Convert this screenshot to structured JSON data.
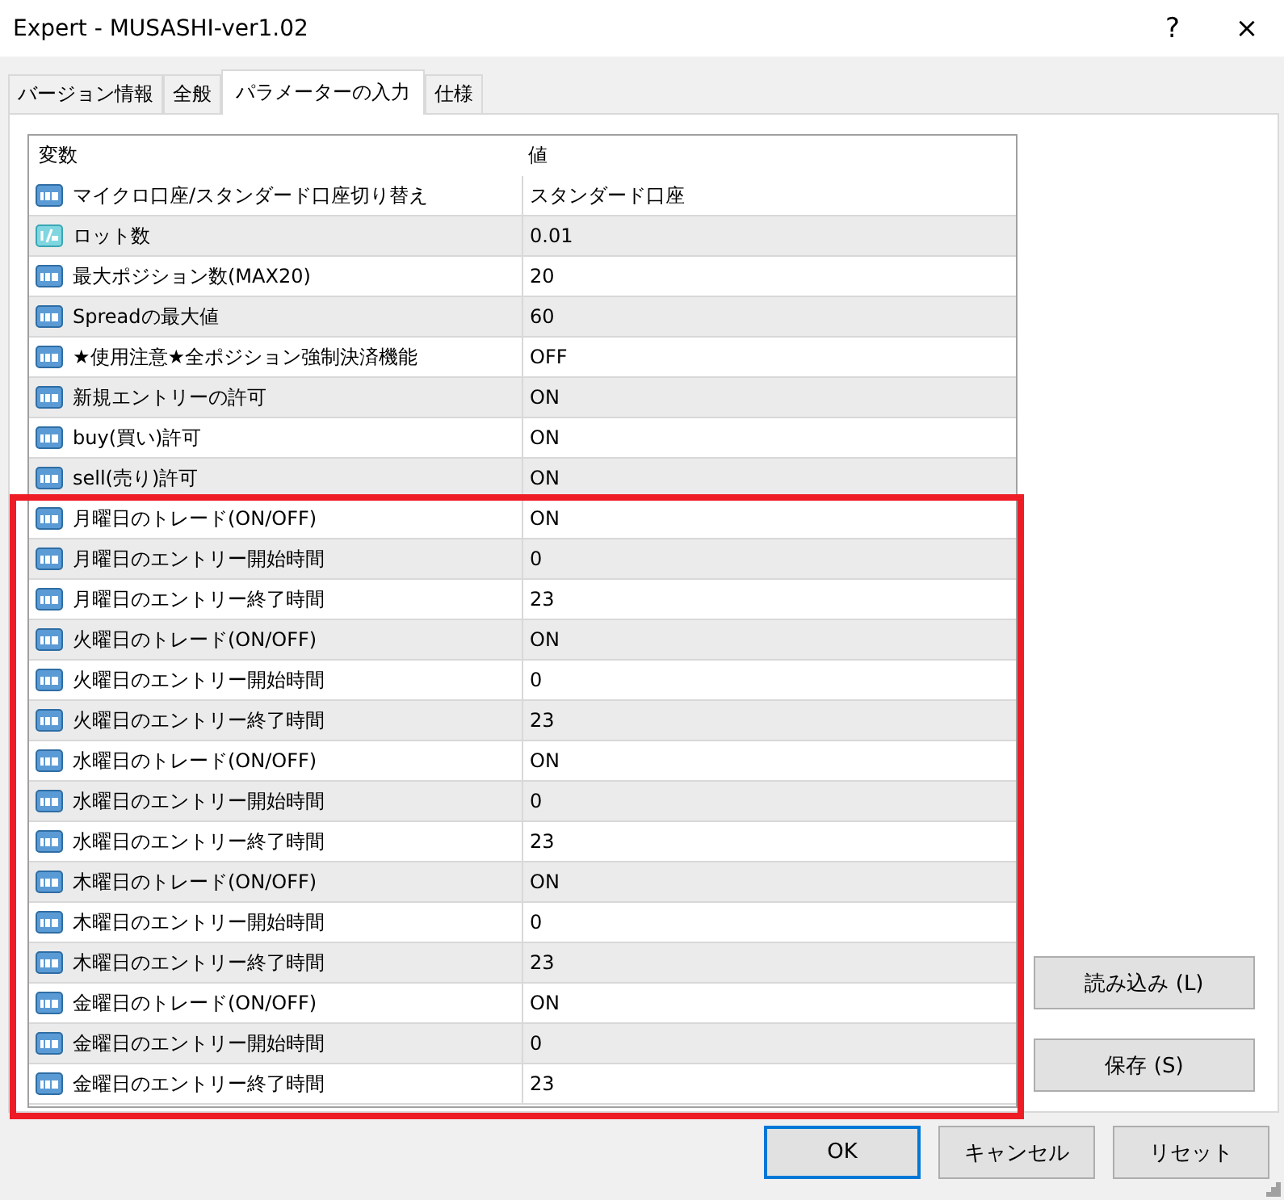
{
  "window": {
    "title": "Expert - MUSASHI-ver1.02",
    "help": "?",
    "close": "×"
  },
  "tabs": [
    {
      "label": "バージョン情報",
      "selected": false
    },
    {
      "label": "全般",
      "selected": false
    },
    {
      "label": "パラメーターの入力",
      "selected": true
    },
    {
      "label": "仕様",
      "selected": false
    }
  ],
  "table": {
    "columns": [
      "変数",
      "値"
    ],
    "rows": [
      {
        "kind": "int",
        "name": "マイクロ口座/スタンダード口座切り替え",
        "value": "スタンダード口座"
      },
      {
        "kind": "double",
        "name": "ロット数",
        "value": "0.01"
      },
      {
        "kind": "int",
        "name": "最大ポジション数(MAX20)",
        "value": "20"
      },
      {
        "kind": "int",
        "name": "Spreadの最大値",
        "value": "60"
      },
      {
        "kind": "int",
        "name": "★使用注意★全ポジション強制決済機能",
        "value": "OFF"
      },
      {
        "kind": "int",
        "name": "新規エントリーの許可",
        "value": "ON"
      },
      {
        "kind": "int",
        "name": "buy(買い)許可",
        "value": "ON"
      },
      {
        "kind": "int",
        "name": "sell(売り)許可",
        "value": "ON"
      }
    ],
    "highlighted_rows": [
      {
        "kind": "int",
        "name": "月曜日のトレード(ON/OFF)",
        "value": "ON"
      },
      {
        "kind": "int",
        "name": "月曜日のエントリー開始時間",
        "value": "0"
      },
      {
        "kind": "int",
        "name": "月曜日のエントリー終了時間",
        "value": "23"
      },
      {
        "kind": "int",
        "name": "火曜日のトレード(ON/OFF)",
        "value": "ON"
      },
      {
        "kind": "int",
        "name": "火曜日のエントリー開始時間",
        "value": "0"
      },
      {
        "kind": "int",
        "name": "火曜日のエントリー終了時間",
        "value": "23"
      },
      {
        "kind": "int",
        "name": "水曜日のトレード(ON/OFF)",
        "value": "ON"
      },
      {
        "kind": "int",
        "name": "水曜日のエントリー開始時間",
        "value": "0"
      },
      {
        "kind": "int",
        "name": "水曜日のエントリー終了時間",
        "value": "23"
      },
      {
        "kind": "int",
        "name": "木曜日のトレード(ON/OFF)",
        "value": "ON"
      },
      {
        "kind": "int",
        "name": "木曜日のエントリー開始時間",
        "value": "0"
      },
      {
        "kind": "int",
        "name": "木曜日のエントリー終了時間",
        "value": "23"
      },
      {
        "kind": "int",
        "name": "金曜日のトレード(ON/OFF)",
        "value": "ON"
      },
      {
        "kind": "int",
        "name": "金曜日のエントリー開始時間",
        "value": "0"
      },
      {
        "kind": "int",
        "name": "金曜日のエントリー終了時間",
        "value": "23"
      }
    ]
  },
  "side_buttons": [
    "読み込み (L)",
    "保存 (S)"
  ],
  "buttons": [
    {
      "label": "OK",
      "default": true
    },
    {
      "label": "キャンセル",
      "default": false
    },
    {
      "label": "リセット",
      "default": false
    }
  ]
}
